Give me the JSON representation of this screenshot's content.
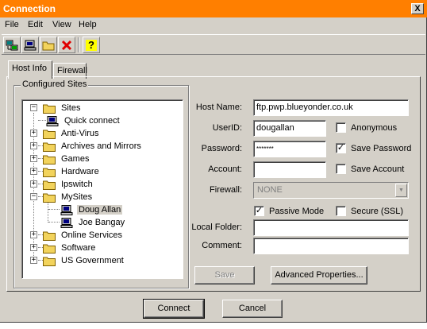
{
  "window": {
    "title": "Connection",
    "close_glyph": "X"
  },
  "menu": [
    "File",
    "Edit",
    "View",
    "Help"
  ],
  "toolbar": {
    "buttons": [
      {
        "icon": "connect-icon"
      },
      {
        "icon": "computer-icon"
      },
      {
        "icon": "folder-icon"
      },
      {
        "icon": "delete-icon"
      },
      {
        "icon": "help-icon",
        "glyph": "?"
      }
    ]
  },
  "tabs": [
    "Host Info",
    "Firewall"
  ],
  "sites": {
    "group_label": "Configured Sites",
    "tree": [
      {
        "label": "Sites",
        "type": "folder",
        "expander": "−"
      },
      {
        "label": "Quick connect",
        "type": "computer"
      },
      {
        "label": "Anti-Virus",
        "type": "folder",
        "expander": "+"
      },
      {
        "label": "Archives and Mirrors",
        "type": "folder",
        "expander": "+"
      },
      {
        "label": "Games",
        "type": "folder",
        "expander": "+"
      },
      {
        "label": "Hardware",
        "type": "folder",
        "expander": "+"
      },
      {
        "label": "Ipswitch",
        "type": "folder",
        "expander": "+"
      },
      {
        "label": "MySites",
        "type": "folder",
        "expander": "−"
      },
      {
        "label": "Doug Allan",
        "type": "computer",
        "selected": true
      },
      {
        "label": "Joe Bangay",
        "type": "computer"
      },
      {
        "label": "Online Services",
        "type": "folder",
        "expander": "+"
      },
      {
        "label": "Software",
        "type": "folder",
        "expander": "+"
      },
      {
        "label": "US Government",
        "type": "folder",
        "expander": "+"
      }
    ]
  },
  "form": {
    "host_name_label": "Host Name:",
    "host_name": "ftp.pwp.blueyonder.co.uk",
    "userid_label": "UserID:",
    "userid": "dougallan",
    "password_label": "Password:",
    "password": "*******",
    "account_label": "Account:",
    "account": "",
    "firewall_label": "Firewall:",
    "firewall": "NONE",
    "local_folder_label": "Local Folder:",
    "local_folder": "",
    "comment_label": "Comment:",
    "comment": "",
    "anonymous_label": "Anonymous",
    "anonymous": false,
    "save_password_label": "Save Password",
    "save_password": true,
    "save_account_label": "Save Account",
    "save_account": false,
    "passive_mode_label": "Passive Mode",
    "passive_mode": true,
    "secure_label": "Secure (SSL)",
    "secure": false,
    "check_glyph": "✓"
  },
  "buttons": {
    "save": "Save",
    "advanced": "Advanced Properties...",
    "connect": "Connect",
    "cancel": "Cancel"
  },
  "colors": {
    "titlebar": "#ff7f00",
    "face": "#d4d0c8",
    "folder": "#f2d35c"
  }
}
